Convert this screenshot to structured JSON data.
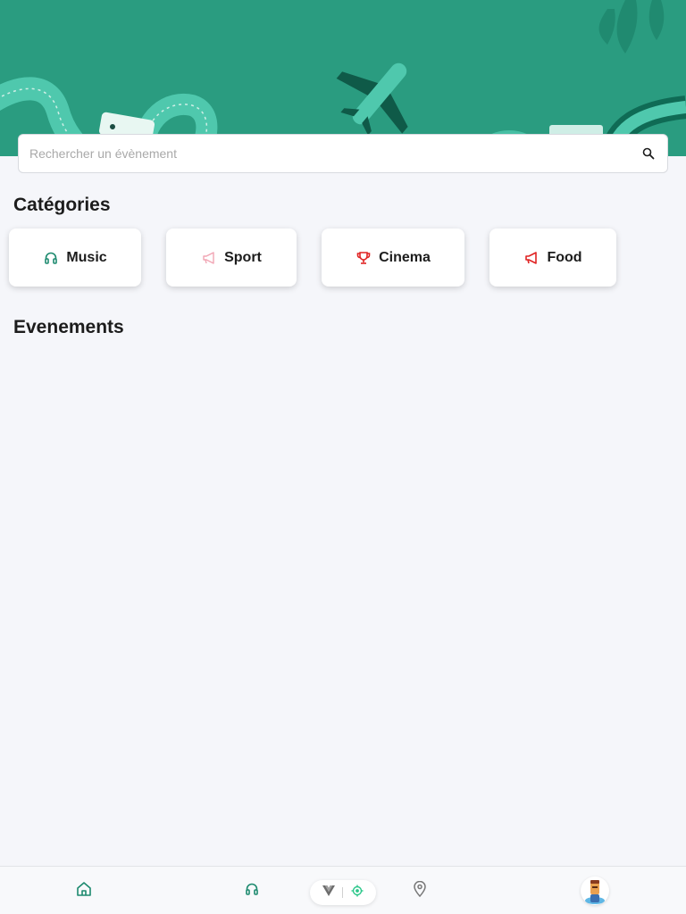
{
  "search": {
    "placeholder": "Rechercher un évènement"
  },
  "sections": {
    "categories_title": "Catégories",
    "events_title": "Evenements"
  },
  "categories": [
    {
      "label": "Music",
      "icon": "headphones-icon",
      "color": "#1d8a6f"
    },
    {
      "label": "Sport",
      "icon": "megaphone-icon",
      "color": "#f1a5b4"
    },
    {
      "label": "Cinema",
      "icon": "trophy-icon",
      "color": "#e02424"
    },
    {
      "label": "Food",
      "icon": "megaphone-icon",
      "color": "#e02424"
    }
  ],
  "bottom_nav": {
    "items": [
      {
        "name": "home",
        "icon": "home-icon"
      },
      {
        "name": "music",
        "icon": "headphones-icon"
      },
      {
        "name": "location",
        "icon": "map-pin-icon"
      },
      {
        "name": "profile",
        "icon": "avatar"
      }
    ],
    "pill_icons": [
      "vue-logo-icon",
      "target-icon"
    ]
  },
  "colors": {
    "accent": "#2a9c80",
    "dark_accent": "#0f6b55",
    "background": "#f5f6fa"
  }
}
